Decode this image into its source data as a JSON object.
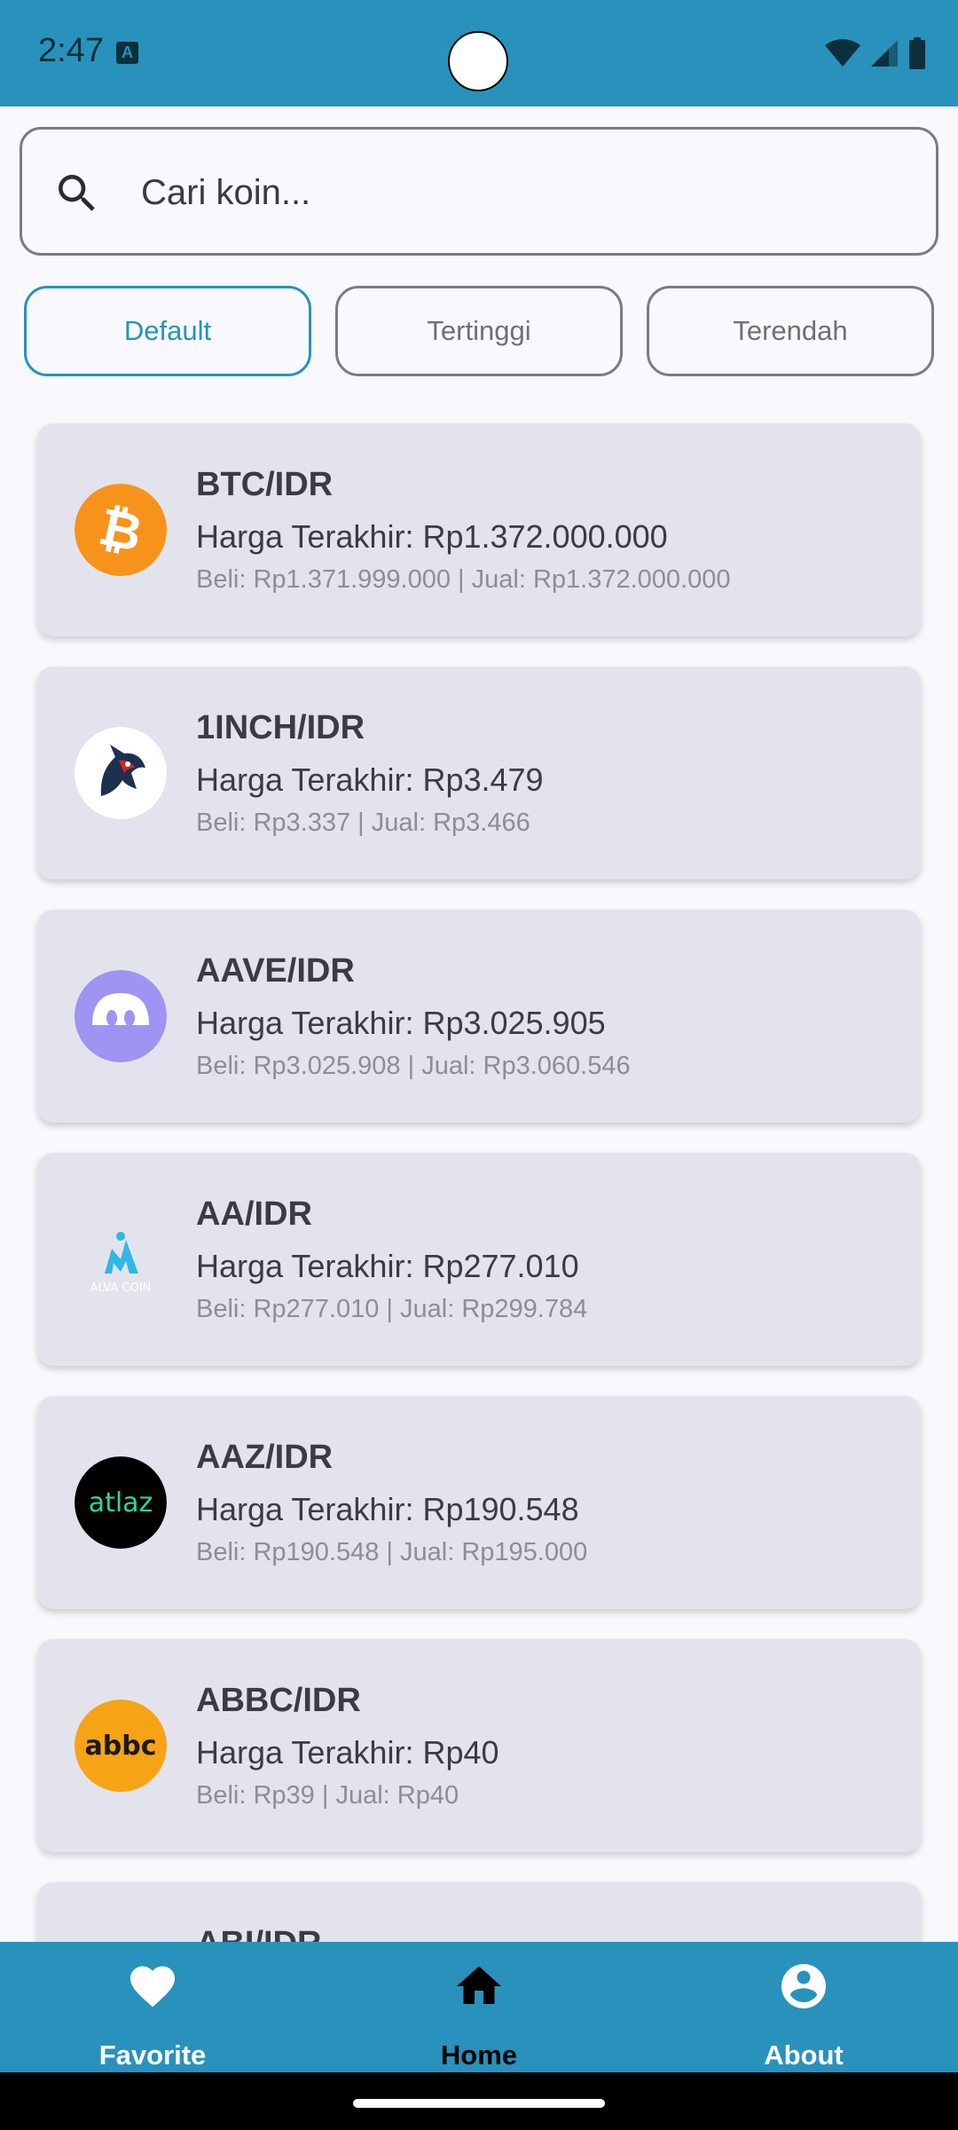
{
  "status_bar": {
    "time": "2:47",
    "notification_badge": "A"
  },
  "search": {
    "placeholder": "Cari koin...",
    "value": ""
  },
  "filters": [
    {
      "label": "Default",
      "active": true
    },
    {
      "label": "Tertinggi",
      "active": false
    },
    {
      "label": "Terendah",
      "active": false
    }
  ],
  "coins": [
    {
      "pair": "BTC/IDR",
      "last": "Harga Terakhir: Rp1.372.000.000",
      "bidask": "Beli: Rp1.371.999.000 | Jual: Rp1.372.000.000",
      "icon": "bitcoin-icon",
      "color": "#f7931a"
    },
    {
      "pair": "1INCH/IDR",
      "last": "Harga Terakhir: Rp3.479",
      "bidask": "Beli: Rp3.337 | Jual: Rp3.466",
      "icon": "unicorn-icon",
      "color": "#ffffff"
    },
    {
      "pair": "AAVE/IDR",
      "last": "Harga Terakhir: Rp3.025.905",
      "bidask": "Beli: Rp3.025.908 | Jual: Rp3.060.546",
      "icon": "aave-ghost-icon",
      "color": "#9e94f3"
    },
    {
      "pair": "AA/IDR",
      "last": "Harga Terakhir: Rp277.010",
      "bidask": "Beli: Rp277.010 | Jual: Rp299.784",
      "icon": "alva-coin-icon",
      "color": "#32b6e8"
    },
    {
      "pair": "AAZ/IDR",
      "last": "Harga Terakhir: Rp190.548",
      "bidask": "Beli: Rp190.548 | Jual: Rp195.000",
      "icon": "atlaz-icon",
      "color": "#000000"
    },
    {
      "pair": "ABBC/IDR",
      "last": "Harga Terakhir: Rp40",
      "bidask": "Beli: Rp39 | Jual: Rp40",
      "icon": "abbc-icon",
      "color": "#f7a316"
    },
    {
      "pair": "ABI/IDR",
      "last": "",
      "bidask": "",
      "icon": "coin-icon",
      "color": "#cccccc"
    }
  ],
  "logo_text": {
    "aa": "ALVA COIN",
    "aaz": "atlaz",
    "abbc": "abbc"
  },
  "bottom_nav": [
    {
      "label": "Favorite",
      "icon": "heart-icon",
      "active": false
    },
    {
      "label": "Home",
      "icon": "home-icon",
      "active": true
    },
    {
      "label": "About",
      "icon": "account-circle-icon",
      "active": false
    }
  ],
  "colors": {
    "primary": "#2892bc",
    "card": "#e3e3ed",
    "background": "#f8f8fd",
    "nav_inactive": "#ffffff",
    "nav_active": "#000000"
  }
}
